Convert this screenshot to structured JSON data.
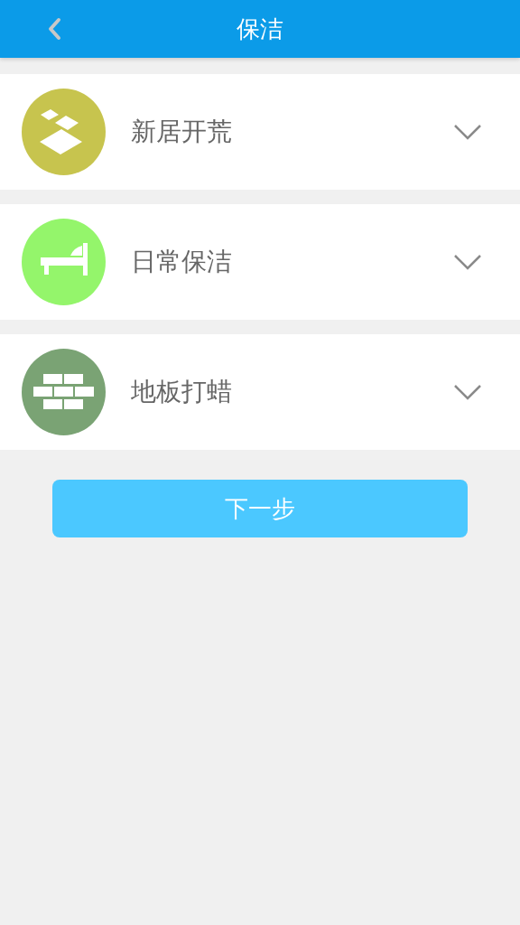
{
  "header": {
    "title": "保洁"
  },
  "services": [
    {
      "kind": "tiles",
      "label": "新居开荒",
      "color": "#c7c44e",
      "expanded": false
    },
    {
      "kind": "bed",
      "label": "日常保洁",
      "color": "#94f56b",
      "expanded": false
    },
    {
      "kind": "bricks",
      "label": "地板打蜡",
      "color": "#7aa374",
      "expanded": false
    }
  ],
  "next_button": "下一步"
}
